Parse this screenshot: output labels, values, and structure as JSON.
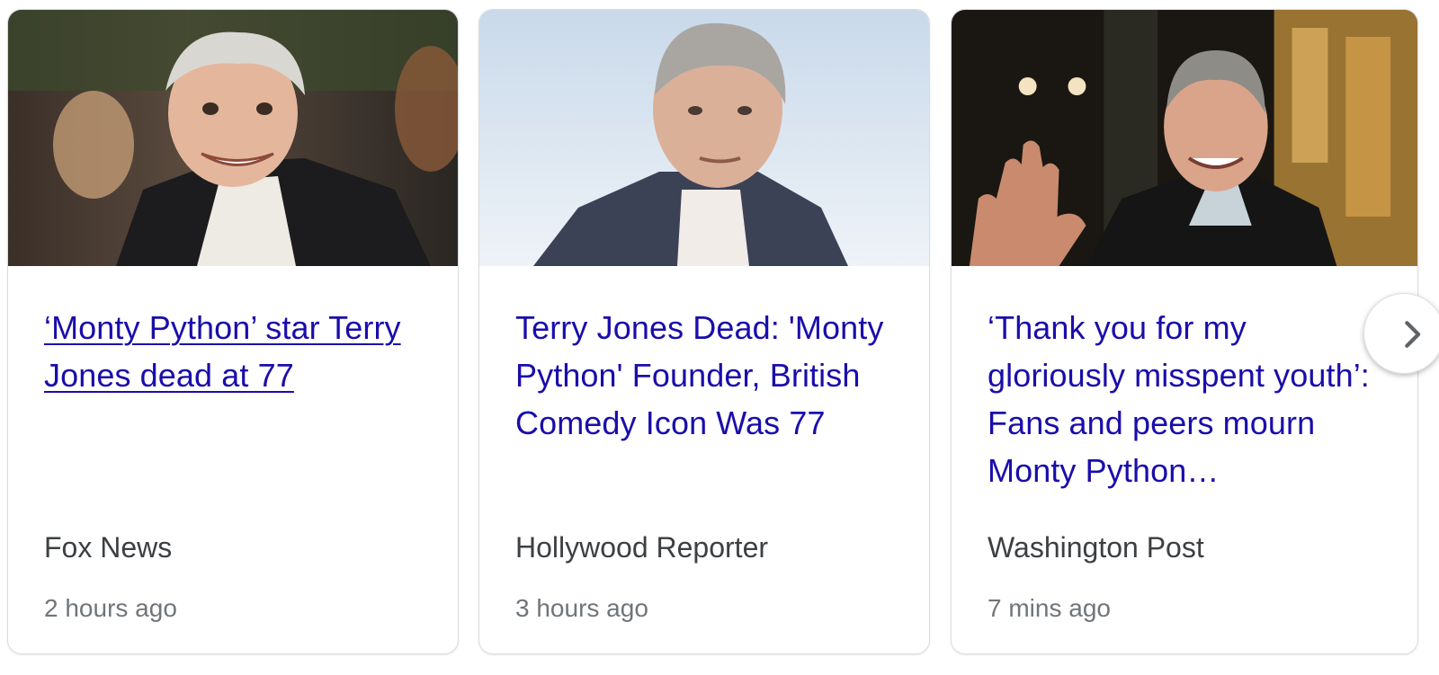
{
  "cards": [
    {
      "headline": "‘Monty Python’ star Terry Jones dead at 77",
      "source": "Fox News",
      "time": "2 hours ago",
      "image_icon": "news-photo-icon"
    },
    {
      "headline": "Terry Jones Dead: 'Monty Python' Founder, British Comedy Icon Was 77",
      "source": "Hollywood Reporter",
      "time": "3 hours ago",
      "image_icon": "news-photo-icon"
    },
    {
      "headline": "‘Thank you for my gloriously misspent youth’: Fans and peers mourn Monty Python…",
      "source": "Washington Post",
      "time": "7 mins ago",
      "image_icon": "news-photo-icon"
    }
  ],
  "next_button": {
    "icon": "chevron-right-icon"
  },
  "colors": {
    "link": "#1a0dab",
    "source": "#3c4043",
    "time": "#70757a",
    "border": "#dadce0"
  }
}
